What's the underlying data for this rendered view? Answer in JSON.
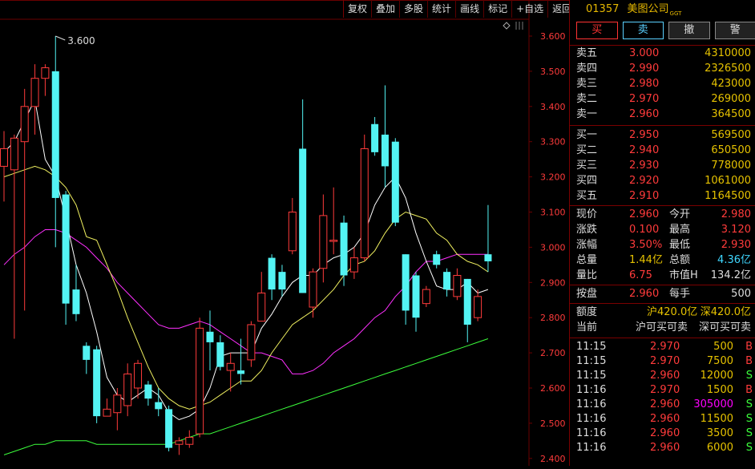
{
  "toolbar": [
    "复权",
    "叠加",
    "多股",
    "统计",
    "画线",
    "标记",
    "+自选",
    "返回"
  ],
  "stock": {
    "code": "01357",
    "name": "美图公司",
    "tag": "GGT"
  },
  "actions": {
    "buy": "买",
    "sell": "卖",
    "cancel": "撤",
    "alert": "警"
  },
  "asks": [
    {
      "label": "卖五",
      "price": "3.000",
      "vol": "4310000"
    },
    {
      "label": "卖四",
      "price": "2.990",
      "vol": "2326500"
    },
    {
      "label": "卖三",
      "price": "2.980",
      "vol": "423000"
    },
    {
      "label": "卖二",
      "price": "2.970",
      "vol": "269000"
    },
    {
      "label": "卖一",
      "price": "2.960",
      "vol": "364500"
    }
  ],
  "bids": [
    {
      "label": "买一",
      "price": "2.950",
      "vol": "569500"
    },
    {
      "label": "买二",
      "price": "2.940",
      "vol": "650500"
    },
    {
      "label": "买三",
      "price": "2.930",
      "vol": "778000"
    },
    {
      "label": "买四",
      "price": "2.920",
      "vol": "1061000"
    },
    {
      "label": "买五",
      "price": "2.910",
      "vol": "1164500"
    }
  ],
  "stats": [
    {
      "l1": "现价",
      "v1": "2.960",
      "l2": "今开",
      "v2": "2.980"
    },
    {
      "l1": "涨跌",
      "v1": "0.100",
      "l2": "最高",
      "v2": "3.120"
    },
    {
      "l1": "涨幅",
      "v1": "3.50%",
      "l2": "最低",
      "v2": "2.930"
    },
    {
      "l1": "总量",
      "v1": "1.44亿",
      "l2": "总额",
      "v2": "4.36亿"
    },
    {
      "l1": "量比",
      "v1": "6.75",
      "l2": "市值H",
      "v2": "134.2亿"
    }
  ],
  "lot": {
    "l1": "按盘",
    "v1": "2.960",
    "l2": "每手",
    "v2": "500"
  },
  "quota": {
    "label": "额度",
    "sh": "沪420.0亿",
    "sz": "深420.0亿",
    "cur_label": "当前",
    "sh_state": "沪可买可卖",
    "sz_state": "深可买可卖"
  },
  "ticks": [
    {
      "t": "11:15",
      "p": "2.970",
      "v": "500",
      "s": "B"
    },
    {
      "t": "11:15",
      "p": "2.970",
      "v": "7500",
      "s": "B"
    },
    {
      "t": "11:15",
      "p": "2.960",
      "v": "12000",
      "s": "S"
    },
    {
      "t": "11:16",
      "p": "2.970",
      "v": "1500",
      "s": "B"
    },
    {
      "t": "11:16",
      "p": "2.960",
      "v": "305000",
      "s": "S"
    },
    {
      "t": "11:16",
      "p": "2.960",
      "v": "11500",
      "s": "S"
    },
    {
      "t": "11:16",
      "p": "2.960",
      "v": "3500",
      "s": "S"
    },
    {
      "t": "11:16",
      "p": "2.960",
      "v": "6000",
      "s": "S"
    }
  ],
  "colors": {
    "up": "#ff3b3b",
    "down": "#53f3f3",
    "ma5": "#ffffff",
    "ma10": "#f0f060",
    "ma20": "#ff30ff",
    "ma60": "#3cff3c",
    "grid": "#6a0000"
  },
  "chart_data": {
    "type": "candlestick",
    "price_axis_ticks": [
      "3.600",
      "3.500",
      "3.400",
      "3.300",
      "3.200",
      "3.100",
      "3.000",
      "2.900",
      "2.800",
      "2.700",
      "2.600",
      "2.500",
      "2.400"
    ],
    "ylim": [
      2.4,
      3.66
    ],
    "high_label": "3.600",
    "candles": [
      {
        "o": 3.23,
        "c": 3.28,
        "h": 3.33,
        "l": 3.13
      },
      {
        "o": 3.22,
        "c": 3.31,
        "h": 3.32,
        "l": 2.74
      },
      {
        "o": 3.3,
        "c": 3.4,
        "h": 3.45,
        "l": 2.82
      },
      {
        "o": 3.4,
        "c": 3.48,
        "h": 3.52,
        "l": 3.32
      },
      {
        "o": 3.48,
        "c": 3.51,
        "h": 3.52,
        "l": 3.43
      },
      {
        "o": 3.5,
        "c": 3.14,
        "h": 3.6,
        "l": 3.0
      },
      {
        "o": 3.15,
        "c": 2.84,
        "h": 3.16,
        "l": 2.78
      },
      {
        "o": 2.88,
        "c": 2.81,
        "h": 2.95,
        "l": 2.79
      },
      {
        "o": 2.72,
        "c": 2.68,
        "h": 2.73,
        "l": 2.64
      },
      {
        "o": 2.71,
        "c": 2.52,
        "h": 2.72,
        "l": 2.5
      },
      {
        "o": 2.52,
        "c": 2.54,
        "h": 2.57,
        "l": 2.52
      },
      {
        "o": 2.53,
        "c": 2.58,
        "h": 2.6,
        "l": 2.48
      },
      {
        "o": 2.55,
        "c": 2.64,
        "h": 2.67,
        "l": 2.52
      },
      {
        "o": 2.6,
        "c": 2.67,
        "h": 2.68,
        "l": 2.57
      },
      {
        "o": 2.61,
        "c": 2.57,
        "h": 2.62,
        "l": 2.55
      },
      {
        "o": 2.56,
        "c": 2.54,
        "h": 2.6,
        "l": 2.52
      },
      {
        "o": 2.54,
        "c": 2.43,
        "h": 2.55,
        "l": 2.42
      },
      {
        "o": 2.44,
        "c": 2.45,
        "h": 2.46,
        "l": 2.41
      },
      {
        "o": 2.44,
        "c": 2.46,
        "h": 2.48,
        "l": 2.43
      },
      {
        "o": 2.47,
        "c": 2.77,
        "h": 2.8,
        "l": 2.46
      },
      {
        "o": 2.76,
        "c": 2.73,
        "h": 2.82,
        "l": 2.65
      },
      {
        "o": 2.73,
        "c": 2.66,
        "h": 2.75,
        "l": 2.65
      },
      {
        "o": 2.65,
        "c": 2.67,
        "h": 2.7,
        "l": 2.59
      },
      {
        "o": 2.65,
        "c": 2.64,
        "h": 2.74,
        "l": 2.61
      },
      {
        "o": 2.68,
        "c": 2.78,
        "h": 2.79,
        "l": 2.66
      },
      {
        "o": 2.79,
        "c": 2.87,
        "h": 2.93,
        "l": 2.79
      },
      {
        "o": 2.97,
        "c": 2.88,
        "h": 2.98,
        "l": 2.85
      },
      {
        "o": 2.93,
        "c": 2.88,
        "h": 2.95,
        "l": 2.86
      },
      {
        "o": 2.99,
        "c": 3.1,
        "h": 3.14,
        "l": 2.98
      },
      {
        "o": 3.28,
        "c": 2.87,
        "h": 3.42,
        "l": 2.87
      },
      {
        "o": 2.83,
        "c": 2.93,
        "h": 2.94,
        "l": 2.8
      },
      {
        "o": 2.94,
        "c": 3.09,
        "h": 3.15,
        "l": 2.9
      },
      {
        "o": 3.02,
        "c": 3.02,
        "h": 3.17,
        "l": 2.98
      },
      {
        "o": 3.07,
        "c": 2.92,
        "h": 3.09,
        "l": 2.89
      },
      {
        "o": 2.93,
        "c": 2.97,
        "h": 3.0,
        "l": 2.91
      },
      {
        "o": 2.97,
        "c": 3.28,
        "h": 3.32,
        "l": 2.96
      },
      {
        "o": 3.35,
        "c": 3.27,
        "h": 3.37,
        "l": 3.26
      },
      {
        "o": 3.32,
        "c": 3.23,
        "h": 3.46,
        "l": 3.17
      },
      {
        "o": 3.3,
        "c": 3.07,
        "h": 3.31,
        "l": 3.06
      },
      {
        "o": 2.98,
        "c": 2.82,
        "h": 2.98,
        "l": 2.78
      },
      {
        "o": 2.92,
        "c": 2.8,
        "h": 2.93,
        "l": 2.76
      },
      {
        "o": 2.84,
        "c": 2.88,
        "h": 2.89,
        "l": 2.83
      },
      {
        "o": 2.98,
        "c": 2.95,
        "h": 2.99,
        "l": 2.94
      },
      {
        "o": 2.93,
        "c": 2.88,
        "h": 2.94,
        "l": 2.86
      },
      {
        "o": 2.86,
        "c": 2.92,
        "h": 2.94,
        "l": 2.85
      },
      {
        "o": 2.91,
        "c": 2.78,
        "h": 2.91,
        "l": 2.73
      },
      {
        "o": 2.8,
        "c": 2.86,
        "h": 2.88,
        "l": 2.79
      },
      {
        "o": 2.98,
        "c": 2.96,
        "h": 3.12,
        "l": 2.93
      }
    ],
    "ma5": [
      3.27,
      3.3,
      3.36,
      3.42,
      3.25,
      3.2,
      3.08,
      2.95,
      2.87,
      2.76,
      2.63,
      2.58,
      2.56,
      2.58,
      2.6,
      2.58,
      2.53,
      2.51,
      2.52,
      2.54,
      2.6,
      2.69,
      2.7,
      2.7,
      2.7,
      2.77,
      2.81,
      2.86,
      2.9,
      2.92,
      2.92,
      2.95,
      2.97,
      2.98,
      3.0,
      3.04,
      3.12,
      3.17,
      3.2,
      3.14,
      3.04,
      2.96,
      2.89,
      2.88,
      2.88,
      2.9,
      2.87,
      2.88
    ],
    "ma10": [
      3.2,
      3.21,
      3.22,
      3.23,
      3.22,
      3.2,
      3.17,
      3.12,
      3.03,
      3.02,
      2.95,
      2.88,
      2.8,
      2.73,
      2.66,
      2.6,
      2.57,
      2.55,
      2.54,
      2.55,
      2.56,
      2.58,
      2.6,
      2.62,
      2.62,
      2.65,
      2.7,
      2.74,
      2.78,
      2.8,
      2.82,
      2.85,
      2.88,
      2.92,
      2.95,
      2.96,
      2.99,
      3.04,
      3.08,
      3.1,
      3.09,
      3.08,
      3.04,
      3.02,
      2.98,
      2.96,
      2.95,
      2.93
    ],
    "ma20": [
      2.95,
      2.98,
      3.0,
      3.03,
      3.05,
      3.05,
      3.04,
      3.02,
      3.0,
      2.97,
      2.94,
      2.9,
      2.87,
      2.84,
      2.81,
      2.78,
      2.77,
      2.77,
      2.78,
      2.79,
      2.78,
      2.76,
      2.74,
      2.72,
      2.7,
      2.7,
      2.69,
      2.68,
      2.64,
      2.64,
      2.65,
      2.67,
      2.7,
      2.72,
      2.74,
      2.77,
      2.8,
      2.82,
      2.86,
      2.89,
      2.93,
      2.96,
      2.96,
      2.97,
      2.98,
      2.98,
      2.98,
      2.98
    ],
    "ma60": [
      2.41,
      2.42,
      2.43,
      2.44,
      2.44,
      2.45,
      2.45,
      2.45,
      2.45,
      2.44,
      2.44,
      2.44,
      2.44,
      2.44,
      2.44,
      2.44,
      2.44,
      2.45,
      2.46,
      2.47,
      2.47,
      2.48,
      2.49,
      2.5,
      2.51,
      2.52,
      2.53,
      2.54,
      2.55,
      2.56,
      2.57,
      2.58,
      2.59,
      2.6,
      2.61,
      2.62,
      2.63,
      2.64,
      2.65,
      2.66,
      2.67,
      2.68,
      2.69,
      2.7,
      2.71,
      2.72,
      2.73,
      2.74
    ]
  }
}
